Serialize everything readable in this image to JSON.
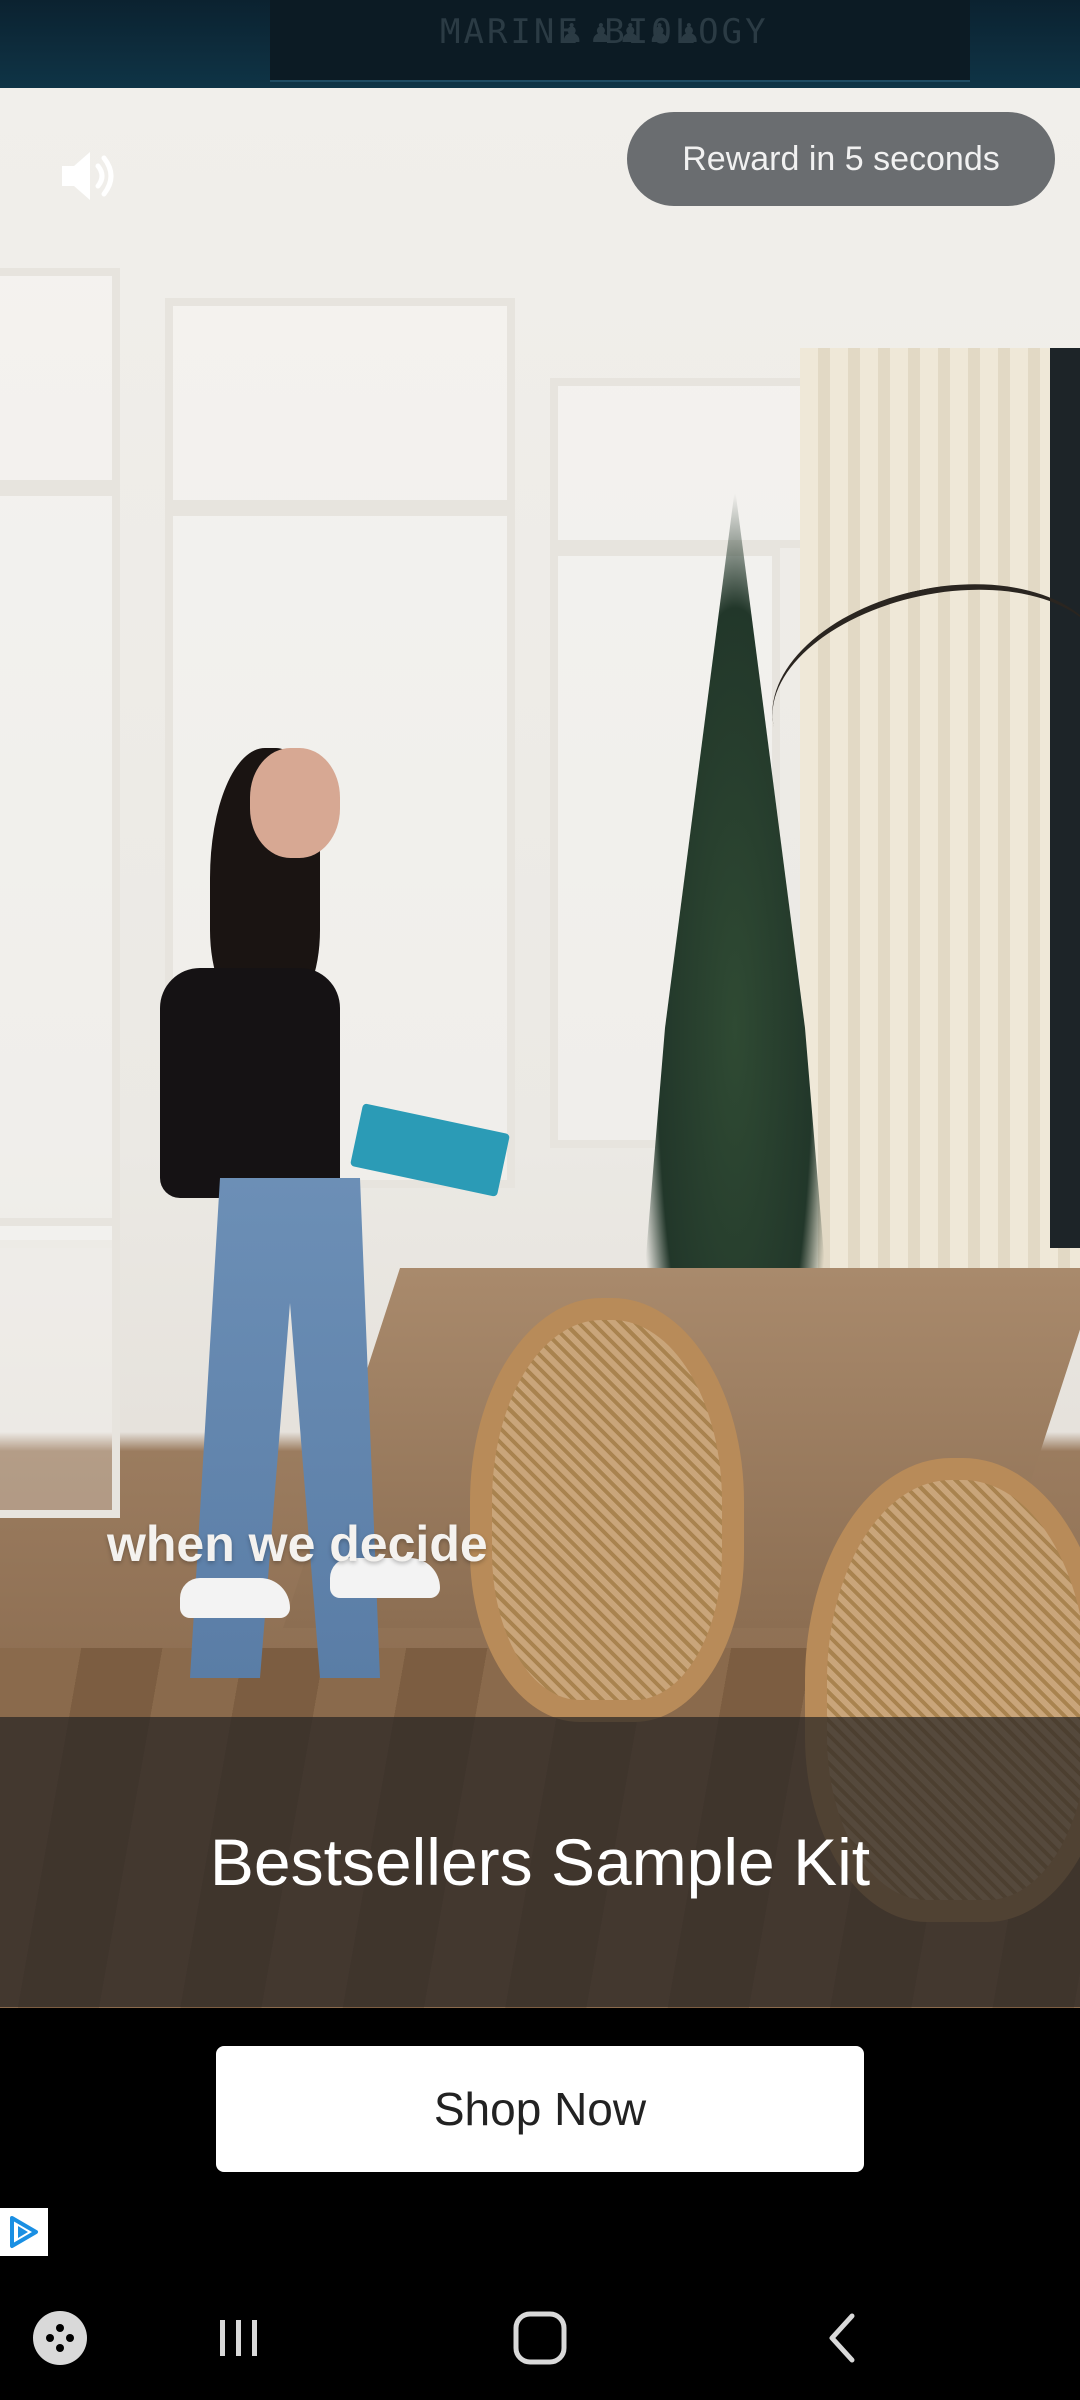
{
  "background_game": {
    "title": "MARINE BIOLOGY"
  },
  "ad": {
    "reward_text": "Reward in 5 seconds",
    "video_caption": "when we decide",
    "product_title": "Bestsellers Sample Kit",
    "cta_label": "Shop Now"
  },
  "icons": {
    "sound": "speaker-icon",
    "adchoices": "adchoices-icon",
    "game_launcher": "gamepad-icon",
    "recents": "recents-icon",
    "home": "home-icon",
    "back": "back-icon"
  },
  "colors": {
    "reward_pill_bg": "#6a6d70",
    "banner_bg": "#282624",
    "cta_bg": "#ffffff",
    "adchoices_blue": "#1a8fe3"
  }
}
